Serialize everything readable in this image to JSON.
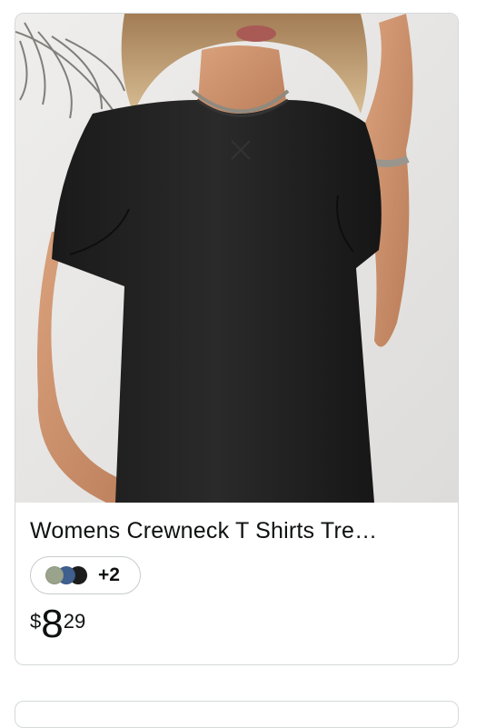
{
  "product": {
    "title": "Womens Crewneck T Shirts Tre…",
    "image_alt": "Woman wearing black crewneck short sleeve t-shirt",
    "swatches": {
      "colors": [
        "#9aa48c",
        "#3f5f8f",
        "#1c1c1c"
      ],
      "more_label": "+2"
    },
    "price": {
      "symbol": "$",
      "whole": "8",
      "fraction": "29"
    }
  }
}
